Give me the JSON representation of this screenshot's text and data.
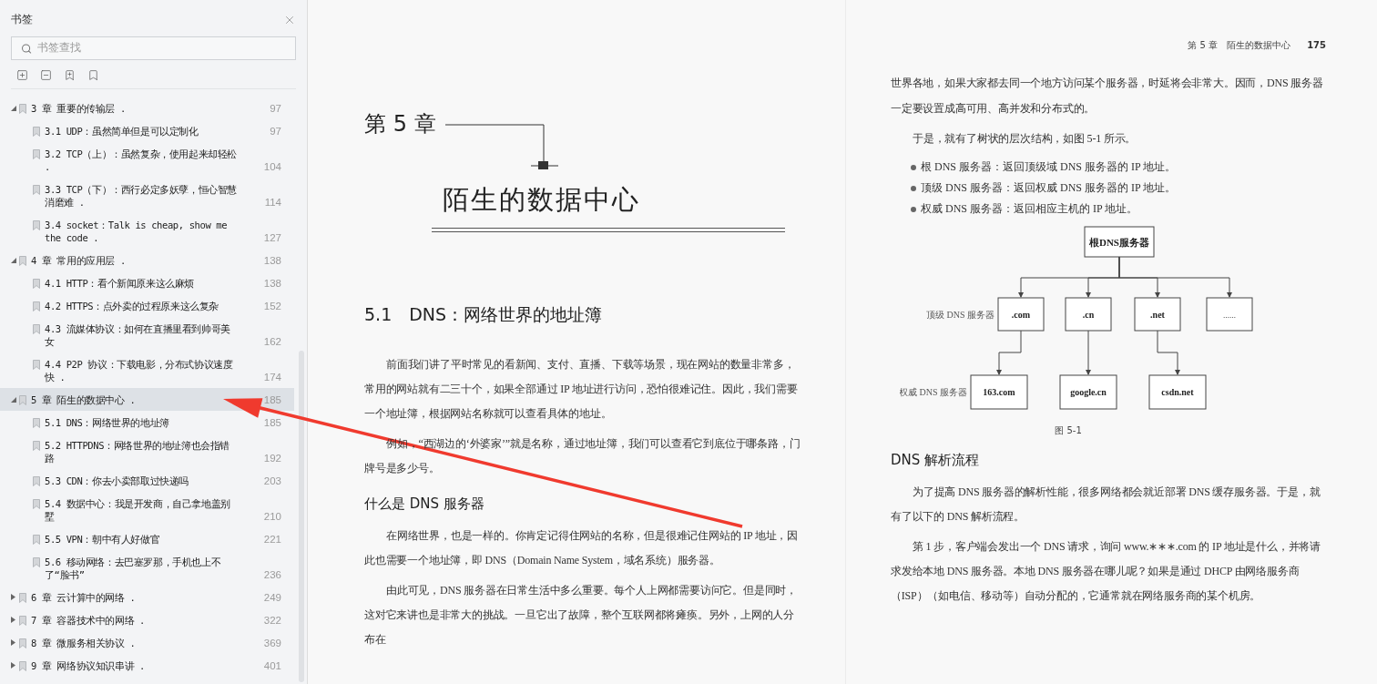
{
  "sidebar": {
    "title": "书签",
    "search": {
      "placeholder": "书签查找"
    },
    "chapters": [
      {
        "label": "3 章  重要的传输层 .",
        "page": "97",
        "expanded": true,
        "selected": false,
        "children": [
          {
            "label": "3.1 UDP：虽然简单但是可以定制化",
            "page": "97",
            "selected": false
          },
          {
            "label": "3.2 TCP（上）：虽然复杂，使用起来却轻松 .",
            "page": "104",
            "selected": false
          },
          {
            "label": "3.3 TCP（下）：西行必定多妖孽，恒心智慧消磨难 .",
            "page": "114",
            "selected": false
          },
          {
            "label": "3.4 socket：Talk is cheap, show me the code .",
            "page": "127",
            "selected": false
          }
        ]
      },
      {
        "label": "4 章  常用的应用层 .",
        "page": "138",
        "expanded": true,
        "selected": false,
        "children": [
          {
            "label": "4.1 HTTP：看个新闻原来这么麻烦",
            "page": "138",
            "selected": false
          },
          {
            "label": "4.2 HTTPS：点外卖的过程原来这么复杂",
            "page": "152",
            "selected": false
          },
          {
            "label": "4.3 流媒体协议：如何在直播里看到帅哥美女",
            "page": "162",
            "selected": false
          },
          {
            "label": "4.4 P2P 协议：下载电影，分布式协议速度快 .",
            "page": "174",
            "selected": false
          }
        ]
      },
      {
        "label": "5 章  陌生的数据中心 .",
        "page": "185",
        "expanded": true,
        "selected": true,
        "children": [
          {
            "label": "5.1 DNS：网络世界的地址簿",
            "page": "185",
            "selected": false
          },
          {
            "label": "5.2 HTTPDNS：网络世界的地址簿也会指错路",
            "page": "192",
            "selected": false
          },
          {
            "label": "5.3 CDN：你去小卖部取过快递吗",
            "page": "203",
            "selected": false
          },
          {
            "label": "5.4 数据中心：我是开发商，自己拿地盖别墅",
            "page": "210",
            "selected": false
          },
          {
            "label": "5.5 VPN：朝中有人好做官",
            "page": "221",
            "selected": false
          },
          {
            "label": "5.6 移动网络：去巴塞罗那，手机也上不了“脸书”",
            "page": "236",
            "selected": false
          }
        ]
      },
      {
        "label": "6 章  云计算中的网络 .",
        "page": "249",
        "expanded": false,
        "selected": false
      },
      {
        "label": "7 章  容器技术中的网络 .",
        "page": "322",
        "expanded": false,
        "selected": false
      },
      {
        "label": "8 章  微服务相关协议 .",
        "page": "369",
        "expanded": false,
        "selected": false
      },
      {
        "label": "9 章  网络协议知识串讲 .",
        "page": "401",
        "expanded": false,
        "selected": false
      }
    ]
  },
  "left_page": {
    "chapter_number": "第 5 章",
    "chapter_title": "陌生的数据中心",
    "section_title": "5.1　DNS：网络世界的地址簿",
    "blocks": [
      {
        "kind": "paragraph",
        "text": "前面我们讲了平时常见的看新闻、支付、直播、下载等场景，现在网站的数量非常多，常用的网站就有二三十个，如果全部通过 IP 地址进行访问，恐怕很难记住。因此，我们需要一个地址簿，根据网站名称就可以查看具体的地址。"
      },
      {
        "kind": "paragraph",
        "text": "例如，“西湖边的‘外婆家’”就是名称，通过地址簿，我们可以查看它到底位于哪条路，门牌号是多少号。"
      },
      {
        "kind": "heading",
        "text": "什么是 DNS 服务器"
      },
      {
        "kind": "paragraph",
        "text": "在网络世界，也是一样的。你肯定记得住网站的名称，但是很难记住网站的 IP 地址，因此也需要一个地址簿，即 DNS（Domain Name System，域名系统）服务器。"
      },
      {
        "kind": "paragraph",
        "text": "由此可见，DNS 服务器在日常生活中多么重要。每个人上网都需要访问它。但是同时，这对它来讲也是非常大的挑战。一旦它出了故障，整个互联网都将瘫痪。另外，上网的人分布在"
      }
    ]
  },
  "right_page": {
    "running_head": "第 5 章　陌生的数据中心",
    "page_number": "175",
    "blocks_before": [
      {
        "kind": "continuation",
        "text": "世界各地，如果大家都去同一个地方访问某个服务器，时延将会非常大。因而，DNS 服务器一定要设置成高可用、高并发和分布式的。"
      },
      {
        "kind": "paragraph",
        "text": "于是，就有了树状的层次结构，如图 5-1 所示。"
      },
      {
        "kind": "bullet",
        "text": "根 DNS 服务器：返回顶级域 DNS 服务器的 IP 地址。"
      },
      {
        "kind": "bullet",
        "text": "顶级 DNS 服务器：返回权威 DNS 服务器的 IP 地址。"
      },
      {
        "kind": "bullet",
        "text": "权威 DNS 服务器：返回相应主机的 IP 地址。"
      }
    ],
    "figure": {
      "root": "根DNS服务器",
      "tld_label": "顶级 DNS 服务器",
      "auth_label": "权威 DNS 服务器",
      "tld_nodes": [
        {
          "text": ".com",
          "child": "163.com"
        },
        {
          "text": ".cn",
          "child": "google.cn"
        },
        {
          "text": ".net",
          "child": "csdn.net"
        },
        {
          "text": "……"
        }
      ],
      "caption": "图 5-1"
    },
    "blocks_after": [
      {
        "kind": "heading",
        "text": "DNS 解析流程"
      },
      {
        "kind": "paragraph",
        "text": "为了提高 DNS 服务器的解析性能，很多网络都会就近部署 DNS 缓存服务器。于是，就有了以下的 DNS 解析流程。"
      },
      {
        "kind": "paragraph",
        "text": "第 1 步，客户端会发出一个 DNS 请求，询问 www.∗∗∗.com 的 IP 地址是什么，并将请求发给本地 DNS 服务器。本地 DNS 服务器在哪儿呢？如果是通过 DHCP 由网络服务商（ISP）（如电信、移动等）自动分配的，它通常就在网络服务商的某个机房。"
      }
    ]
  }
}
